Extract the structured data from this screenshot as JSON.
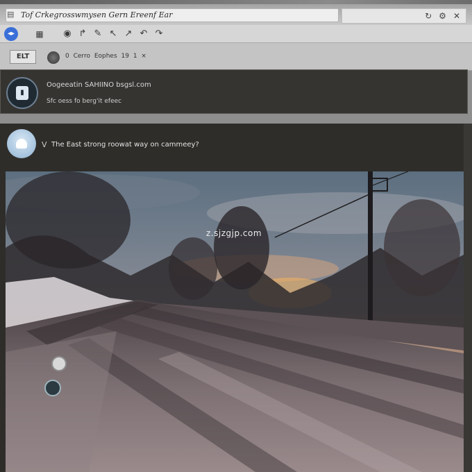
{
  "window": {
    "title": "Tof Crkegrosswmysen Gern Ereenf Ear",
    "doc_icon": "document-icon",
    "controls": [
      "↻",
      "⚙",
      "✕"
    ]
  },
  "toolbar": {
    "home_icon": "home-icon",
    "calendar_icon": "calendar-icon",
    "items": [
      "◉",
      "↱",
      "✎",
      "↖",
      "↗",
      "↶",
      "↷"
    ]
  },
  "subbar": {
    "badge": "ELT",
    "meta": "0 Cerro Eophes 19 1 ×"
  },
  "notice": {
    "line1": "Oogeeatin SAHIINO bsgsl.com",
    "line2": "Sfc oess fo berg'it efeec"
  },
  "post": {
    "chevron": "V",
    "question": "The East strong roowat way on cammeey?"
  },
  "photo": {
    "watermark": "z.sjzgjp.com",
    "description_icon": "photo-icon"
  }
}
